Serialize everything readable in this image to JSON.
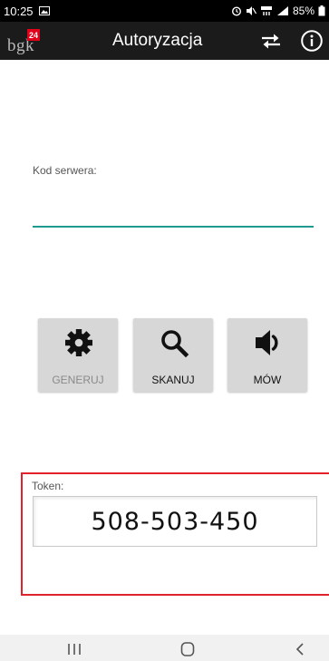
{
  "status_bar": {
    "time": "10:25",
    "battery": "85%"
  },
  "app_bar": {
    "logo_text": "bgk",
    "logo_badge": "24",
    "title": "Autoryzacja",
    "swap_icon": "swap-arrows-icon",
    "info_icon": "info-icon"
  },
  "server": {
    "label": "Kod serwera:",
    "value": "",
    "placeholder": ""
  },
  "actions": [
    {
      "label": "GENERUJ",
      "icon": "gear-icon",
      "enabled": false
    },
    {
      "label": "SKANUJ",
      "icon": "search-icon",
      "enabled": true
    },
    {
      "label": "MÓW",
      "icon": "speaker-icon",
      "enabled": true
    }
  ],
  "token": {
    "label": "Token:",
    "value": "508-503-450"
  },
  "colors": {
    "accent_underline": "#1e9a8e",
    "highlight_frame": "#e1222a",
    "app_bar": "#1b1b1b",
    "logo_badge": "#e3001b"
  },
  "nav_bar": {
    "recent_icon": "recent-apps-icon",
    "home_icon": "home-icon",
    "back_icon": "back-icon"
  }
}
